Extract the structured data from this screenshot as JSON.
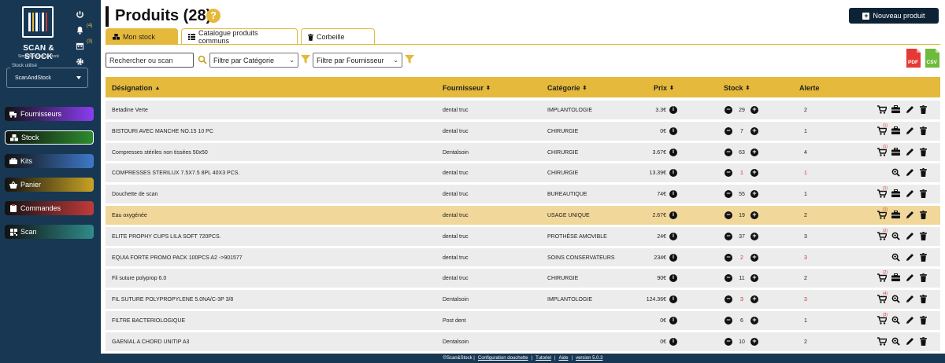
{
  "sidebar": {
    "brand": "SCAN & STOCK",
    "tagline": "Simplifiez-vous le stock",
    "notif_count": "(4)",
    "calendar_count": "(3)",
    "stock_label": "Stock utilisé",
    "stock_value": "ScanAndStock",
    "nav": [
      {
        "label": "Fournisseurs",
        "color": "#8b3df0"
      },
      {
        "label": "Stock",
        "color": "#2e8b2e"
      },
      {
        "label": "Kits",
        "color": "#3f78c8"
      },
      {
        "label": "Panier",
        "color": "#c9a324"
      },
      {
        "label": "Commandes",
        "color": "#c23a3a"
      },
      {
        "label": "Scan",
        "color": "#2f8c8a"
      }
    ]
  },
  "header": {
    "title": "Produits (28)",
    "help": "?",
    "new_button": "Nouveau produit"
  },
  "tabs": [
    {
      "label": "Mon stock"
    },
    {
      "label": "Catalogue produits communs"
    },
    {
      "label": "Corbeille"
    }
  ],
  "filters": {
    "search_placeholder": "Rechercher ou scan",
    "category": "Filtre par Catégorie",
    "supplier": "Filtre par Fournisseur"
  },
  "exports": {
    "pdf": "PDF",
    "csv": "CSV"
  },
  "table": {
    "columns": {
      "designation": "Désignation",
      "fournisseur": "Fournisseur",
      "categorie": "Catégorie",
      "prix": "Prix",
      "stock": "Stock",
      "alerte": "Alerte"
    },
    "rows": [
      {
        "designation": "Betadine Verte",
        "fournisseur": "dental truc",
        "categorie": "IMPLANTOLOGIE",
        "prix": "3.3€",
        "stock": "29",
        "alerte": "2",
        "low": false,
        "cart": "",
        "kit": true,
        "search": false,
        "hl": false
      },
      {
        "designation": "BISTOURI AVEC MANCHE NO.15 10 PC",
        "fournisseur": "dental truc",
        "categorie": "CHIRURGIE",
        "prix": "0€",
        "stock": "7",
        "alerte": "1",
        "low": false,
        "cart": "(1)",
        "kit": true,
        "search": false,
        "hl": false
      },
      {
        "designation": "Compresses stériles non tissées 50x50",
        "fournisseur": "Dentalsoin",
        "categorie": "CHIRURGIE",
        "prix": "3.67€",
        "stock": "63",
        "alerte": "4",
        "low": false,
        "cart": "(1)",
        "kit": true,
        "search": false,
        "hl": false
      },
      {
        "designation": "COMPRESSES STERILUX 7.5X7.5 8PL 40X3 PCS.",
        "fournisseur": "dental truc",
        "categorie": "CHIRURGIE",
        "prix": "13.39€",
        "stock": "1",
        "alerte": "1",
        "low": true,
        "cart": null,
        "kit": false,
        "search": true,
        "hl": false
      },
      {
        "designation": "Douchette de scan",
        "fournisseur": "dental truc",
        "categorie": "BUREAUTIQUE",
        "prix": "74€",
        "stock": "55",
        "alerte": "1",
        "low": false,
        "cart": "(1)",
        "kit": true,
        "search": false,
        "hl": false
      },
      {
        "designation": "Eau oxygénée",
        "fournisseur": "dental truc",
        "categorie": "USAGE UNIQUE",
        "prix": "2.67€",
        "stock": "19",
        "alerte": "2",
        "low": false,
        "cart": "(1)",
        "kit": true,
        "search": false,
        "hl": true
      },
      {
        "designation": "ELITE PROPHY CUPS LILA SOFT 720PCS.",
        "fournisseur": "dental truc",
        "categorie": "PROTHÈSE AMOVIBLE",
        "prix": "24€",
        "stock": "37",
        "alerte": "3",
        "low": false,
        "cart": "(2)",
        "kit": false,
        "search": true,
        "hl": false
      },
      {
        "designation": "EQUIA FORTE PROMO PACK 100PCS A2 ->901577",
        "fournisseur": "dental truc",
        "categorie": "SOINS CONSERVATEURS",
        "prix": "234€",
        "stock": "2",
        "alerte": "3",
        "low": true,
        "cart": null,
        "kit": false,
        "search": true,
        "hl": false
      },
      {
        "designation": "Fil suture polyprop 6.0",
        "fournisseur": "dental truc",
        "categorie": "CHIRURGIE",
        "prix": "90€",
        "stock": "11",
        "alerte": "2",
        "low": false,
        "cart": "(2)",
        "kit": true,
        "search": false,
        "hl": false
      },
      {
        "designation": "FIL SUTURE POLYPROPYLENE 5.0NA/C-3P 3/8",
        "fournisseur": "Dentalsoin",
        "categorie": "IMPLANTOLOGIE",
        "prix": "124.36€",
        "stock": "3",
        "alerte": "3",
        "low": true,
        "cart": "(4)",
        "kit": false,
        "search": true,
        "hl": false
      },
      {
        "designation": "FILTRE BACTERIOLOGIQUE",
        "fournisseur": "Post dent",
        "categorie": "",
        "prix": "0€",
        "stock": "6",
        "alerte": "1",
        "low": false,
        "cart": "(3)",
        "kit": false,
        "search": true,
        "hl": false
      },
      {
        "designation": "GAENIAL A CHORD UNITIP A3",
        "fournisseur": "Dentalsoin",
        "categorie": "",
        "prix": "0€",
        "stock": "10",
        "alerte": "2",
        "low": false,
        "cart": "",
        "kit": false,
        "search": true,
        "hl": false
      }
    ]
  },
  "footer": {
    "copyright": "©Scan&Stock |",
    "config": "Configuration douchette",
    "sep1": "|",
    "tuto": "Tutoriel",
    "sep2": "|",
    "aide": "Aide",
    "sep3": "|",
    "version": "version 5.0.3"
  },
  "colors": {
    "accent": "#e5b93b",
    "sidebar": "#173753",
    "alert": "#d0332a"
  }
}
